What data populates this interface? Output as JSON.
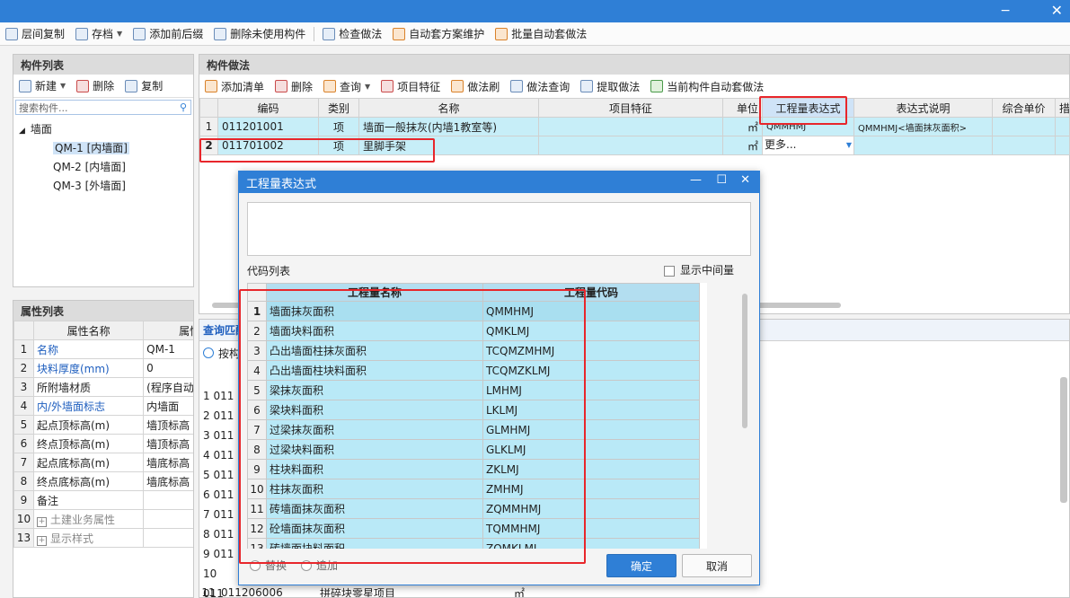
{
  "toolbar": {
    "items": [
      "层间复制",
      "存档",
      "添加前后缀",
      "删除未使用构件",
      "检查做法",
      "自动套方案维护",
      "批量自动套做法"
    ]
  },
  "component_list": {
    "title": "构件列表",
    "new_label": "新建",
    "delete_label": "删除",
    "copy_label": "复制",
    "search_placeholder": "搜索构件...",
    "tree_root": "墙面",
    "tree_items": [
      "QM-1 [内墙面]",
      "QM-2 [内墙面]",
      "QM-3 [外墙面]"
    ]
  },
  "property_list": {
    "title": "属性列表",
    "col_name": "属性名称",
    "col_value": "属性值",
    "rows": [
      {
        "n": "1",
        "name": "名称",
        "value": "QM-1"
      },
      {
        "n": "2",
        "name": "块料厚度(mm)",
        "value": "0"
      },
      {
        "n": "3",
        "name": "所附墙材质",
        "value": "(程序自动判断)"
      },
      {
        "n": "4",
        "name": "内/外墙面标志",
        "value": "内墙面"
      },
      {
        "n": "5",
        "name": "起点顶标高(m)",
        "value": "墙顶标高"
      },
      {
        "n": "6",
        "name": "终点顶标高(m)",
        "value": "墙顶标高"
      },
      {
        "n": "7",
        "name": "起点底标高(m)",
        "value": "墙底标高"
      },
      {
        "n": "8",
        "name": "终点底标高(m)",
        "value": "墙底标高"
      },
      {
        "n": "9",
        "name": "备注",
        "value": ""
      },
      {
        "n": "10",
        "name": "土建业务属性",
        "value": ""
      },
      {
        "n": "13",
        "name": "显示样式",
        "value": ""
      }
    ]
  },
  "method": {
    "title": "构件做法",
    "toolbar": [
      "添加清单",
      "删除",
      "查询",
      "项目特征",
      "做法刷",
      "做法查询",
      "提取做法",
      "当前构件自动套做法"
    ],
    "headers": [
      "编码",
      "类别",
      "名称",
      "项目特征",
      "单位",
      "工程量表达式",
      "表达式说明",
      "综合单价",
      "措"
    ],
    "rows": [
      {
        "n": "1",
        "code": "011201001",
        "type": "项",
        "name": "墙面一般抹灰(内墙1教室等)",
        "feature": "",
        "unit": "㎡",
        "expr": "QMMHMJ",
        "desc": "QMMHMJ<墙面抹灰面积>"
      },
      {
        "n": "2",
        "code": "011701002",
        "type": "项",
        "name": "里脚手架",
        "feature": "",
        "unit": "㎡",
        "expr": "更多...",
        "desc": ""
      }
    ]
  },
  "lower": {
    "tab": "查询匹配",
    "radio": "按构",
    "row_nums": [
      "1",
      "2",
      "3",
      "4",
      "5",
      "6",
      "7",
      "8",
      "9",
      "10",
      "11"
    ],
    "code_prefix": "011",
    "last_code": "011206006",
    "last_name": "拼碎块零星项目",
    "last_unit": "㎡"
  },
  "dialog": {
    "title": "工程量表达式",
    "code_list_label": "代码列表",
    "show_intermediate": "显示中间量",
    "col_name": "工程量名称",
    "col_code": "工程量代码",
    "rows": [
      {
        "n": "1",
        "name": "墙面抹灰面积",
        "code": "QMMHMJ"
      },
      {
        "n": "2",
        "name": "墙面块料面积",
        "code": "QMKLMJ"
      },
      {
        "n": "3",
        "name": "凸出墙面柱抹灰面积",
        "code": "TCQMZMHMJ"
      },
      {
        "n": "4",
        "name": "凸出墙面柱块料面积",
        "code": "TCQMZKLMJ"
      },
      {
        "n": "5",
        "name": "梁抹灰面积",
        "code": "LMHMJ"
      },
      {
        "n": "6",
        "name": "梁块料面积",
        "code": "LKLMJ"
      },
      {
        "n": "7",
        "name": "过梁抹灰面积",
        "code": "GLMHMJ"
      },
      {
        "n": "8",
        "name": "过梁块料面积",
        "code": "GLKLMJ"
      },
      {
        "n": "9",
        "name": "柱块料面积",
        "code": "ZKLMJ"
      },
      {
        "n": "10",
        "name": "柱抹灰面积",
        "code": "ZMHMJ"
      },
      {
        "n": "11",
        "name": "砖墙面抹灰面积",
        "code": "ZQMMHMJ"
      },
      {
        "n": "12",
        "name": "砼墙面抹灰面积",
        "code": "TQMMHMJ"
      },
      {
        "n": "13",
        "name": "砖墙面块料面积",
        "code": "ZQMKLMJ"
      }
    ],
    "replace_label": "替换",
    "append_label": "追加",
    "ok_label": "确定",
    "cancel_label": "取消"
  }
}
